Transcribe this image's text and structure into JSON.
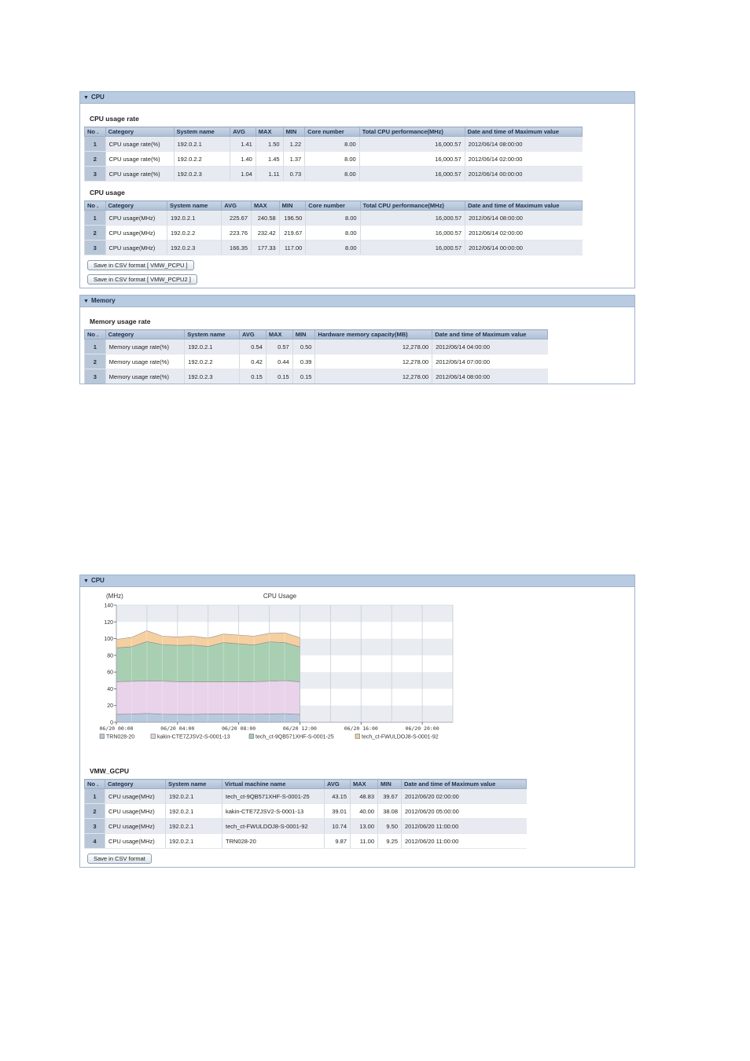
{
  "panel1": {
    "header": "CPU",
    "cpu_usage_rate": {
      "title": "CPU usage rate",
      "columns": [
        "No .",
        "Category",
        "System name",
        "AVG",
        "MAX",
        "MIN",
        "Core number",
        "Total CPU performance(MHz)",
        "Date and time of Maximum value"
      ],
      "rows": [
        [
          "1",
          "CPU usage rate(%)",
          "192.0.2.1",
          "1.41",
          "1.50",
          "1.22",
          "8.00",
          "16,000.57",
          "2012/06/14 08:00:00"
        ],
        [
          "2",
          "CPU usage rate(%)",
          "192.0.2.2",
          "1.40",
          "1.45",
          "1.37",
          "8.00",
          "16,000.57",
          "2012/06/14 02:00:00"
        ],
        [
          "3",
          "CPU usage rate(%)",
          "192.0.2.3",
          "1.04",
          "1.11",
          "0.73",
          "8.00",
          "16,000.57",
          "2012/06/14 00:00:00"
        ]
      ]
    },
    "cpu_usage": {
      "title": "CPU usage",
      "columns": [
        "No .",
        "Category",
        "System name",
        "AVG",
        "MAX",
        "MIN",
        "Core number",
        "Total CPU performance(MHz)",
        "Date and time of Maximum value"
      ],
      "rows": [
        [
          "1",
          "CPU usage(MHz)",
          "192.0.2.1",
          "225.67",
          "240.58",
          "196.50",
          "8.00",
          "16,000.57",
          "2012/06/14 08:00:00"
        ],
        [
          "2",
          "CPU usage(MHz)",
          "192.0.2.2",
          "223.76",
          "232.42",
          "219.67",
          "8.00",
          "16,000.57",
          "2012/06/14 02:00:00"
        ],
        [
          "3",
          "CPU usage(MHz)",
          "192.0.2.3",
          "166.35",
          "177.33",
          "117.00",
          "8.00",
          "16,000.57",
          "2012/06/14 00:00:00"
        ]
      ]
    },
    "buttons": [
      "Save in CSV format [ VMW_PCPU ]",
      "Save in CSV format [ VMW_PCPU2 ]"
    ]
  },
  "panel2": {
    "header": "Memory",
    "memory_usage_rate": {
      "title": "Memory usage rate",
      "columns": [
        "No .",
        "Category",
        "System name",
        "AVG",
        "MAX",
        "MIN",
        "Hardware memory capacity(MB)",
        "Date and time of Maximum value"
      ],
      "rows": [
        [
          "1",
          "Memory usage rate(%)",
          "192.0.2.1",
          "0.54",
          "0.57",
          "0.50",
          "12,278.00",
          "2012/06/14 04:00:00"
        ],
        [
          "2",
          "Memory usage rate(%)",
          "192.0.2.2",
          "0.42",
          "0.44",
          "0.39",
          "12,278.00",
          "2012/06/14 07:00:00"
        ],
        [
          "3",
          "Memory usage rate(%)",
          "192.0.2.3",
          "0.15",
          "0.15",
          "0.15",
          "12,278.00",
          "2012/06/14 08:00:00"
        ]
      ]
    }
  },
  "panel3": {
    "header": "CPU",
    "vmw_gcpu": {
      "title": "VMW_GCPU",
      "columns": [
        "No .",
        "Category",
        "System name",
        "Virtual machine name",
        "AVG",
        "MAX",
        "MIN",
        "Date and time of Maximum value"
      ],
      "rows": [
        [
          "1",
          "CPU usage(MHz)",
          "192.0.2.1",
          "tech_ct-9QB571XHF-S-0001-25",
          "43.15",
          "48.83",
          "39.67",
          "2012/06/20 02:00:00"
        ],
        [
          "2",
          "CPU usage(MHz)",
          "192.0.2.1",
          "kakin-CTE7ZJSV2-S-0001-13",
          "39.01",
          "40.00",
          "38.08",
          "2012/06/20 05:00:00"
        ],
        [
          "3",
          "CPU usage(MHz)",
          "192.0.2.1",
          "tech_ct-FWULDOJ8-S-0001-92",
          "10.74",
          "13.00",
          "9.50",
          "2012/06/20 11:00:00"
        ],
        [
          "4",
          "CPU usage(MHz)",
          "192.0.2.1",
          "TRN028-20",
          "9.87",
          "11.00",
          "9.25",
          "2012/06/20 11:00:00"
        ]
      ]
    },
    "button": "Save in CSV format"
  },
  "chart_data": {
    "type": "area",
    "title": "CPU Usage",
    "ylabel": "(MHz)",
    "xlabel": "",
    "ylim": [
      0,
      140
    ],
    "yticks": [
      0,
      20,
      40,
      60,
      80,
      100,
      120,
      140
    ],
    "xlim": [
      0,
      22
    ],
    "xticks": [
      {
        "x": 0,
        "label": "06/20 00:00"
      },
      {
        "x": 4,
        "label": "06/20 04:00"
      },
      {
        "x": 8,
        "label": "06/20 08:00"
      },
      {
        "x": 12,
        "label": "06/20 12:00"
      },
      {
        "x": 16,
        "label": "06/20 16:00"
      },
      {
        "x": 20,
        "label": "06/20 20:00"
      }
    ],
    "grid": true,
    "stacked": true,
    "legend_position": "bottom",
    "x": [
      0,
      1,
      2,
      3,
      4,
      5,
      6,
      7,
      8,
      9,
      10,
      11,
      12
    ],
    "series": [
      {
        "name": "TRN028-20",
        "color": "#b9c9dd",
        "values": [
          9.5,
          9.8,
          10.5,
          9.7,
          9.6,
          9.5,
          9.9,
          10.1,
          9.8,
          9.6,
          9.9,
          10.3,
          9.5
        ]
      },
      {
        "name": "kakin-CTE7ZJSV2-S-0001-13",
        "color": "#e8d3ea",
        "values": [
          39.0,
          39.2,
          38.8,
          39.5,
          39.0,
          38.9,
          38.4,
          38.2,
          38.6,
          39.0,
          39.2,
          39.6,
          38.8
        ]
      },
      {
        "name": "tech_ct-9QB571XHF-S-0001-25",
        "color": "#a9cfb3",
        "values": [
          40.5,
          41.3,
          47.2,
          43.7,
          43.3,
          44.0,
          42.3,
          47.0,
          45.4,
          43.8,
          47.1,
          45.4,
          41.7
        ]
      },
      {
        "name": "tech_ct-FWULDOJ8-S-0001-92",
        "color": "#f6cfa0",
        "values": [
          10.0,
          11.2,
          13.0,
          10.1,
          10.1,
          10.6,
          9.9,
          10.2,
          10.5,
          10.6,
          10.0,
          11.7,
          11.0
        ]
      }
    ]
  }
}
